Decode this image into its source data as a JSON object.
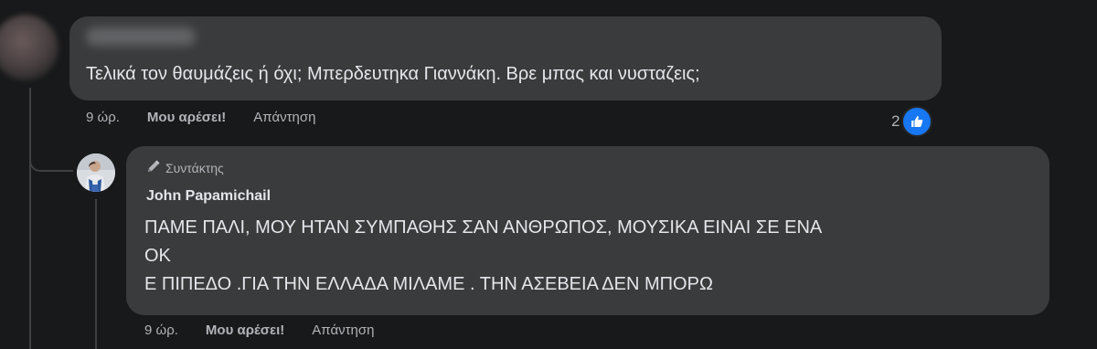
{
  "comment_1": {
    "author_name": "",
    "text": "Τελικά τον θαυμάζεις ή όχι; Μπερδευτηκα Γιαννάκη. Βρε μπας και νυσταζεις;",
    "time": "9 ώρ.",
    "like_label": "Μου αρέσει!",
    "reply_label": "Απάντηση",
    "reaction_count": "2",
    "reaction_icon": "like-icon"
  },
  "comment_2": {
    "badge": "Συντάκτης",
    "badge_icon": "pencil-icon",
    "author_name": "John Papamichail",
    "text_lines": [
      "ΠΑΜΕ ΠΑΛΙ, ΜΟΥ ΗΤΑΝ ΣΥΜΠΑΘΗΣ ΣΑΝ ΑΝΘΡΩΠΟΣ, ΜΟΥΣΙΚΑ ΕΙΝΑΙ ΣΕ ΕΝΑ",
      "ΟΚ",
      "Ε ΠΙΠΕΔΟ .ΓΙΑ ΤΗΝ ΕΛΛΑΔΑ ΜΙΛΑΜΕ . ΤΗΝ ΑΣΕΒΕΙΑ ΔΕΝ ΜΠΟΡΩ"
    ],
    "time": "9 ώρ.",
    "like_label": "Μου αρέσει!",
    "reply_label": "Απάντηση"
  },
  "colors": {
    "background": "#18191a",
    "bubble": "#3a3b3c",
    "primary_text": "#e4e6eb",
    "secondary_text": "#b0b3b8",
    "like_blue": "#1877f2"
  }
}
